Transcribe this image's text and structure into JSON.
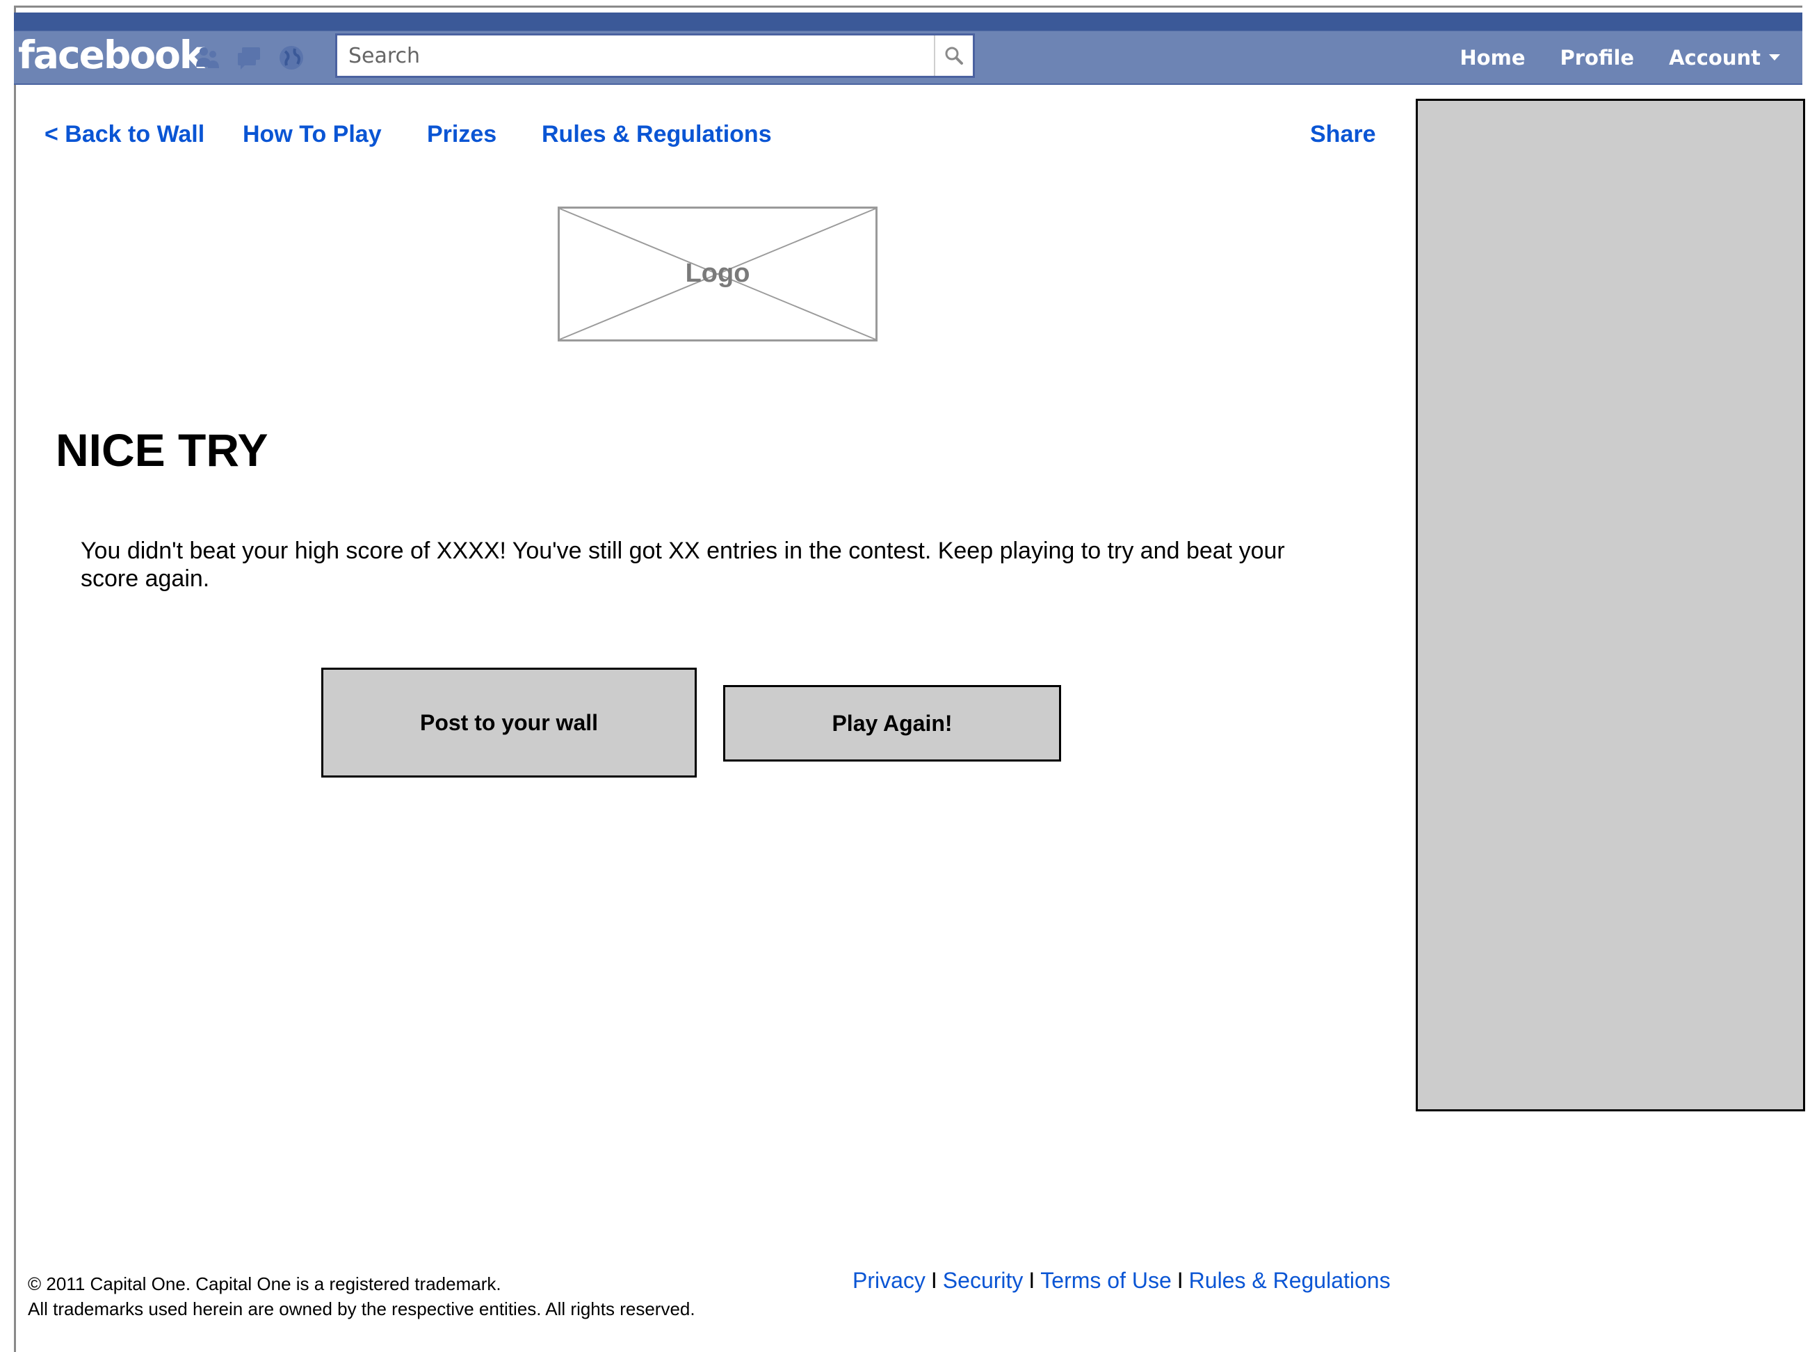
{
  "topbar": {
    "logo": "facebook",
    "jewels": [
      "friend-requests-icon",
      "messages-icon",
      "notifications-globe-icon"
    ],
    "search": {
      "placeholder": "Search",
      "value": ""
    },
    "nav": {
      "home": "Home",
      "profile": "Profile",
      "account": "Account"
    },
    "colors": {
      "bar_dark": "#3b5998",
      "bar_light": "#6d84b4"
    }
  },
  "subnav": {
    "back": "< Back to Wall",
    "how_to_play": "How To Play",
    "prizes": "Prizes",
    "rules": "Rules & Regulations",
    "share": "Share"
  },
  "logo_placeholder": "Logo",
  "headline": "NICE TRY",
  "message": "You didn't beat your high score of XXXX! You've still got XX entries in the contest. Keep playing to try and beat your score again.",
  "buttons": {
    "post": "Post to your wall",
    "play_again": "Play Again!"
  },
  "footer": {
    "legal_line1": "© 2011 Capital One. Capital One is a registered trademark.",
    "legal_line2": "All trademarks used herein are owned by the respective entities. All rights reserved.",
    "links": {
      "privacy": "Privacy",
      "security": "Security",
      "terms": "Terms of Use",
      "rules": "Rules & Regulations"
    },
    "separator": "I"
  },
  "colors": {
    "link": "#0a55d4",
    "button_fill": "#cccccc",
    "ad_fill": "#cccccc"
  }
}
